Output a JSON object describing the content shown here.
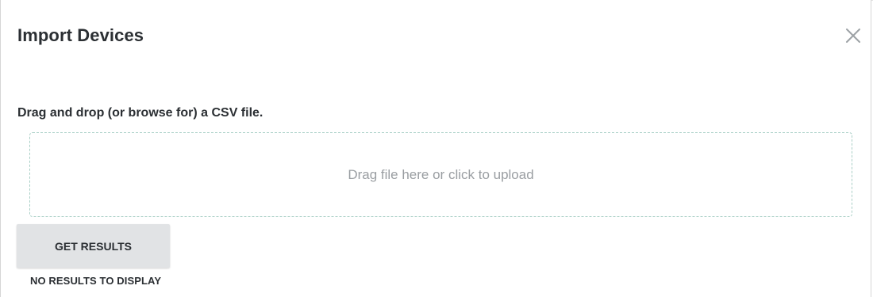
{
  "dialog": {
    "title": "Import Devices",
    "close_icon": "close-icon"
  },
  "upload": {
    "instruction": "Drag and drop (or browse for) a CSV file.",
    "dropzone_text": "Drag file here or click to upload"
  },
  "actions": {
    "get_results_label": "GET RESULTS"
  },
  "results": {
    "empty_text": "NO RESULTS TO DISPLAY"
  },
  "colors": {
    "dropzone_border": "#a9cfc6",
    "button_bg": "#e1e3e5",
    "text": "#2b2f33",
    "muted_text": "#9a9ea2"
  }
}
